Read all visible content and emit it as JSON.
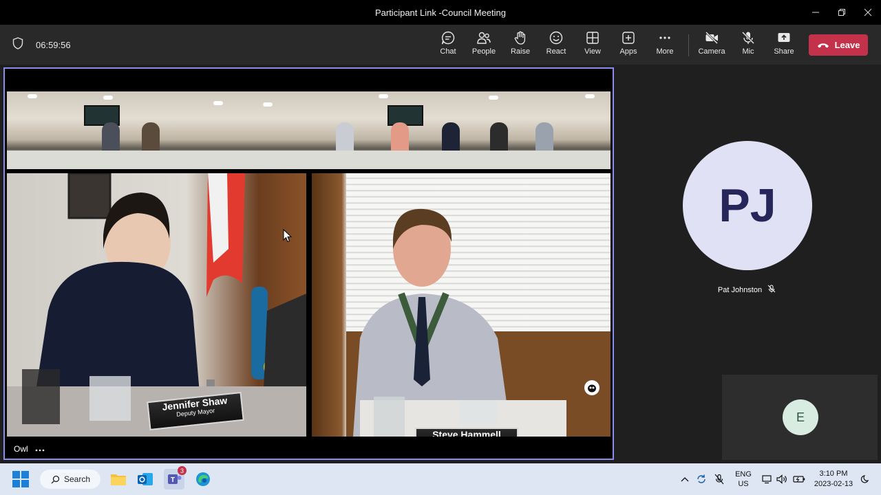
{
  "window": {
    "title": "Participant Link -Council Meeting",
    "controls": [
      "minimize-icon",
      "restore-icon",
      "close-icon"
    ]
  },
  "toolbar": {
    "timer": "06:59:56",
    "buttons": [
      {
        "id": "chat",
        "label": "Chat",
        "icon": "chat-icon"
      },
      {
        "id": "people",
        "label": "People",
        "icon": "people-icon"
      },
      {
        "id": "raise",
        "label": "Raise",
        "icon": "hand-icon"
      },
      {
        "id": "react",
        "label": "React",
        "icon": "smiley-icon"
      },
      {
        "id": "view",
        "label": "View",
        "icon": "grid-icon"
      },
      {
        "id": "apps",
        "label": "Apps",
        "icon": "plus-icon"
      },
      {
        "id": "more",
        "label": "More",
        "icon": "ellipsis-icon"
      },
      {
        "id": "camera",
        "label": "Camera",
        "icon": "camera-off-icon"
      },
      {
        "id": "mic",
        "label": "Mic",
        "icon": "mic-off-icon"
      },
      {
        "id": "share",
        "label": "Share",
        "icon": "share-icon"
      }
    ],
    "leave_label": "Leave",
    "leave_color": "#c4314b"
  },
  "stage": {
    "main_video": {
      "label": "Owl",
      "border_color": "#8b8cf0",
      "nameplates": [
        {
          "name": "Jennifer Shaw",
          "title": "Deputy Mayor"
        },
        {
          "name": "Steve Hammell",
          "title": ""
        }
      ]
    },
    "participant": {
      "initials": "PJ",
      "name": "Pat Johnston",
      "muted": true
    },
    "self_view": {
      "initials": "E"
    }
  },
  "taskbar": {
    "search_label": "Search",
    "teams_badge": "3",
    "language_line1": "ENG",
    "language_line2": "US",
    "time": "3:10 PM",
    "date": "2023-02-13"
  }
}
